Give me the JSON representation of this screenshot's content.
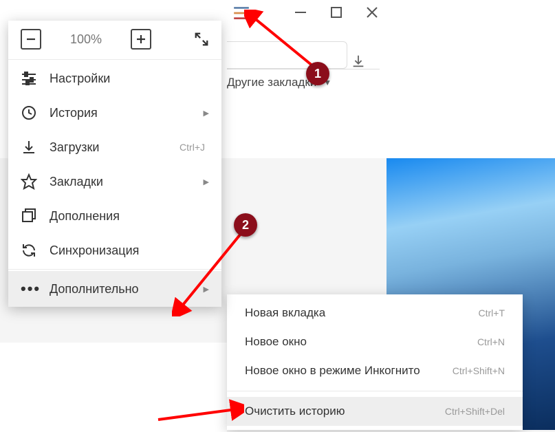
{
  "zoom": {
    "value": "100%"
  },
  "menu": {
    "settings": "Настройки",
    "history": "История",
    "downloads": "Загрузки",
    "downloads_shortcut": "Ctrl+J",
    "bookmarks": "Закладки",
    "addons": "Дополнения",
    "sync": "Синхронизация",
    "more": "Дополнительно"
  },
  "bookmarks_bar": {
    "other": "Другие закладки"
  },
  "submenu": {
    "new_tab": "Новая вкладка",
    "new_tab_sc": "Ctrl+T",
    "new_window": "Новое окно",
    "new_window_sc": "Ctrl+N",
    "incognito": "Новое окно в режиме Инкогнито",
    "incognito_sc": "Ctrl+Shift+N",
    "clear_history": "Очистить историю",
    "clear_history_sc": "Ctrl+Shift+Del"
  },
  "annotations": {
    "badge1": "1",
    "badge2": "2"
  }
}
